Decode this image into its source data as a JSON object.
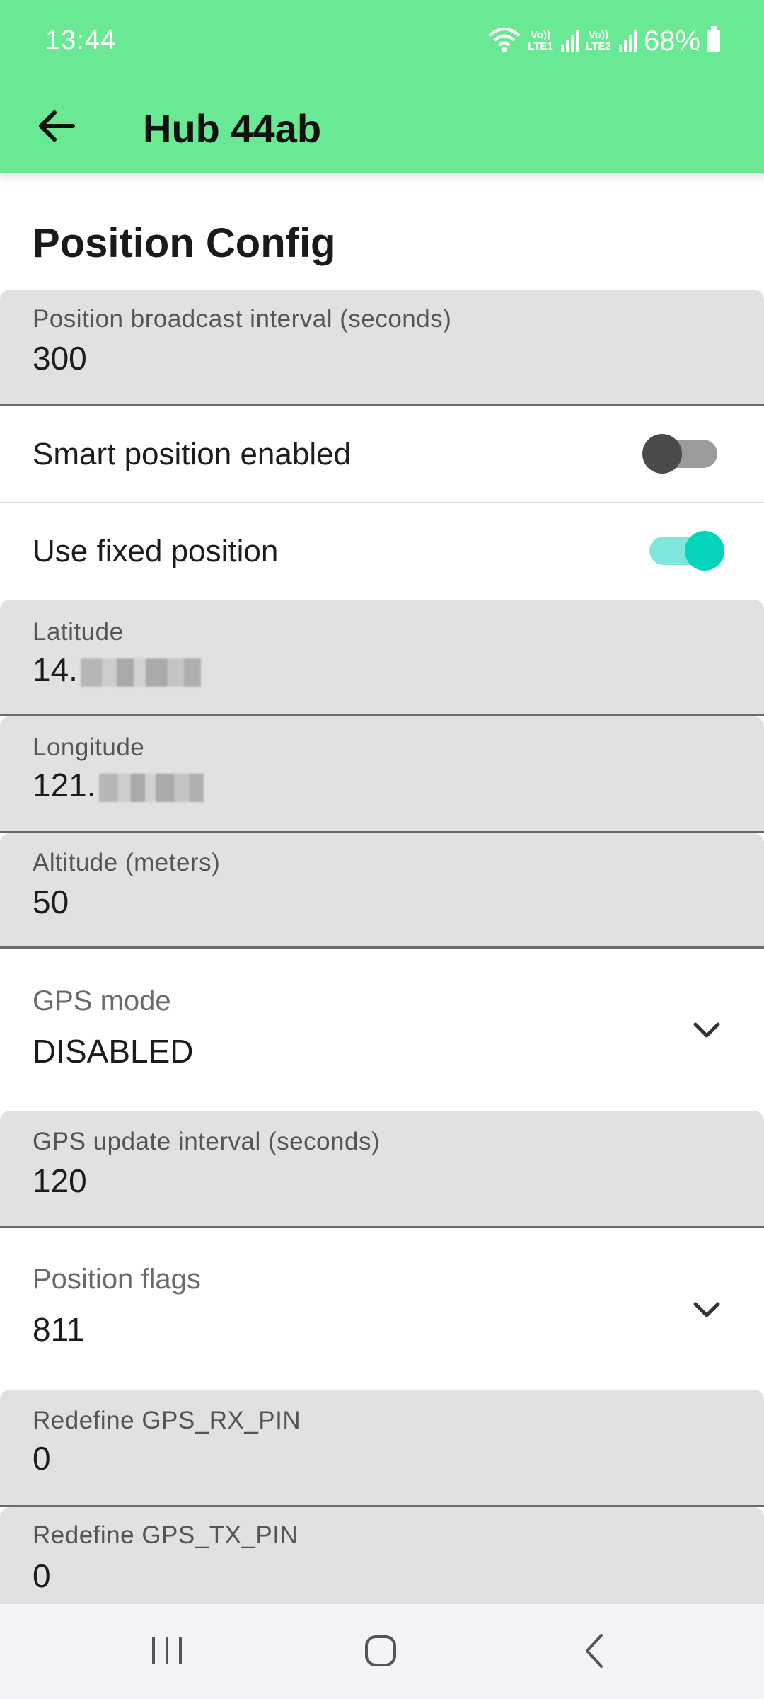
{
  "status_bar": {
    "time": "13:44",
    "sim1_label": "Vo)) LTE1",
    "sim2_label": "Vo)) LTE2",
    "battery": "68%"
  },
  "app_bar": {
    "title": "Hub 44ab"
  },
  "section": {
    "title": "Position Config"
  },
  "fields": {
    "broadcast_interval": {
      "label": "Position broadcast interval (seconds)",
      "value": "300"
    },
    "latitude": {
      "label": "Latitude",
      "value": "14."
    },
    "longitude": {
      "label": "Longitude",
      "value": "121."
    },
    "altitude": {
      "label": "Altitude (meters)",
      "value": "50"
    },
    "gps_update_interval": {
      "label": "GPS update interval (seconds)",
      "value": "120"
    },
    "gps_rx_pin": {
      "label": "Redefine GPS_RX_PIN",
      "value": "0"
    },
    "gps_tx_pin": {
      "label": "Redefine GPS_TX_PIN",
      "value": "0"
    }
  },
  "toggles": {
    "smart_position": {
      "label": "Smart position enabled",
      "checked": false
    },
    "fixed_position": {
      "label": "Use fixed position",
      "checked": true
    }
  },
  "dropdowns": {
    "gps_mode": {
      "label": "GPS mode",
      "value": "DISABLED"
    },
    "position_flags": {
      "label": "Position flags",
      "value": "811"
    }
  },
  "colors": {
    "app_bar": "#69e994",
    "switch_on_track": "#7ee7dc",
    "switch_on_knob": "#05d4bd",
    "field_background": "#e1e1e1"
  },
  "icons": {
    "back": "arrow-left-icon",
    "dropdown": "chevron-down-icon",
    "nav_recents": "recents-icon",
    "nav_home": "home-icon",
    "nav_back": "nav-back-icon"
  }
}
